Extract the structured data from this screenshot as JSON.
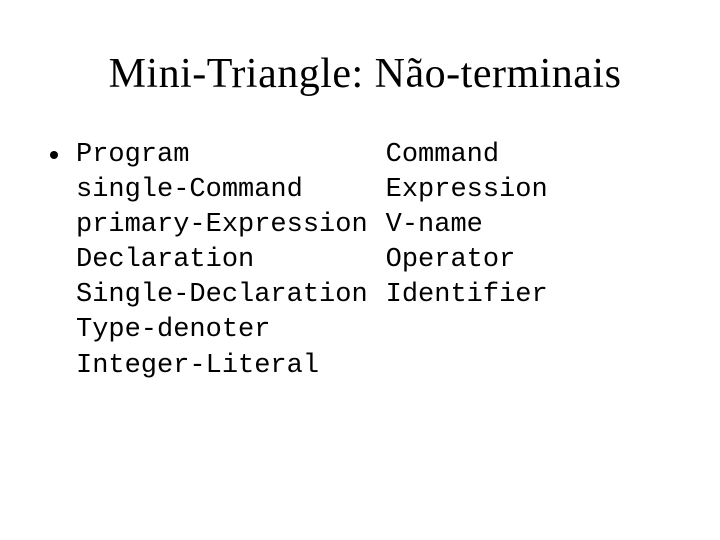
{
  "title": "Mini-Triangle: Não-terminais",
  "left_column": "Program\nsingle-Command\nprimary-Expression\nDeclaration\nSingle-Declaration\nType-denoter\nInteger-Literal",
  "right_column": "Command\nExpression\nV-name\nOperator\nIdentifier"
}
